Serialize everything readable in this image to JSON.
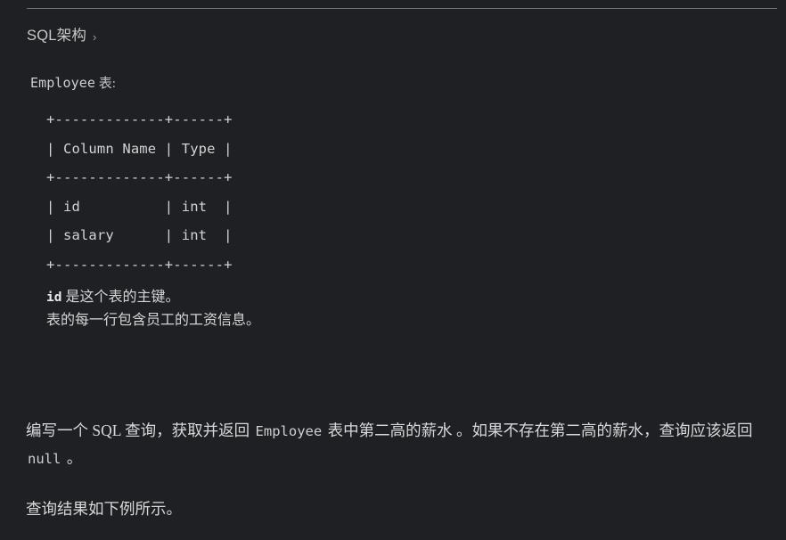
{
  "page": {
    "background_color": "#1e2023",
    "text_color": "#d6d6d6",
    "rule_color": "#6f7479"
  },
  "schema_disclosure": {
    "label": "SQL架构",
    "chevron": "›"
  },
  "schema": {
    "table_caption_code": "Employee",
    "table_caption_suffix": " 表:",
    "ascii_table": "+-------------+------+\n| Column Name | Type |\n+-------------+------+\n| id          | int  |\n| salary      | int  |\n+-------------+------+",
    "columns": [
      {
        "name": "Column Name",
        "type": "Type"
      },
      {
        "name": "id",
        "type": "int"
      },
      {
        "name": "salary",
        "type": "int"
      }
    ],
    "notes": [
      {
        "code": "id",
        "text": " 是这个表的主键。"
      },
      {
        "code": "",
        "text": "表的每一行包含员工的工资信息。"
      }
    ]
  },
  "description": {
    "paragraph1_part1": "编写一个 SQL 查询，获取并返回 ",
    "paragraph1_code1": "Employee",
    "paragraph1_part2": " 表中第二高的薪水 。如果不存在第二高的薪水，查询应该返回 ",
    "paragraph1_code2": "null",
    "paragraph1_part3": " 。",
    "paragraph2": "查询结果如下例所示。"
  }
}
